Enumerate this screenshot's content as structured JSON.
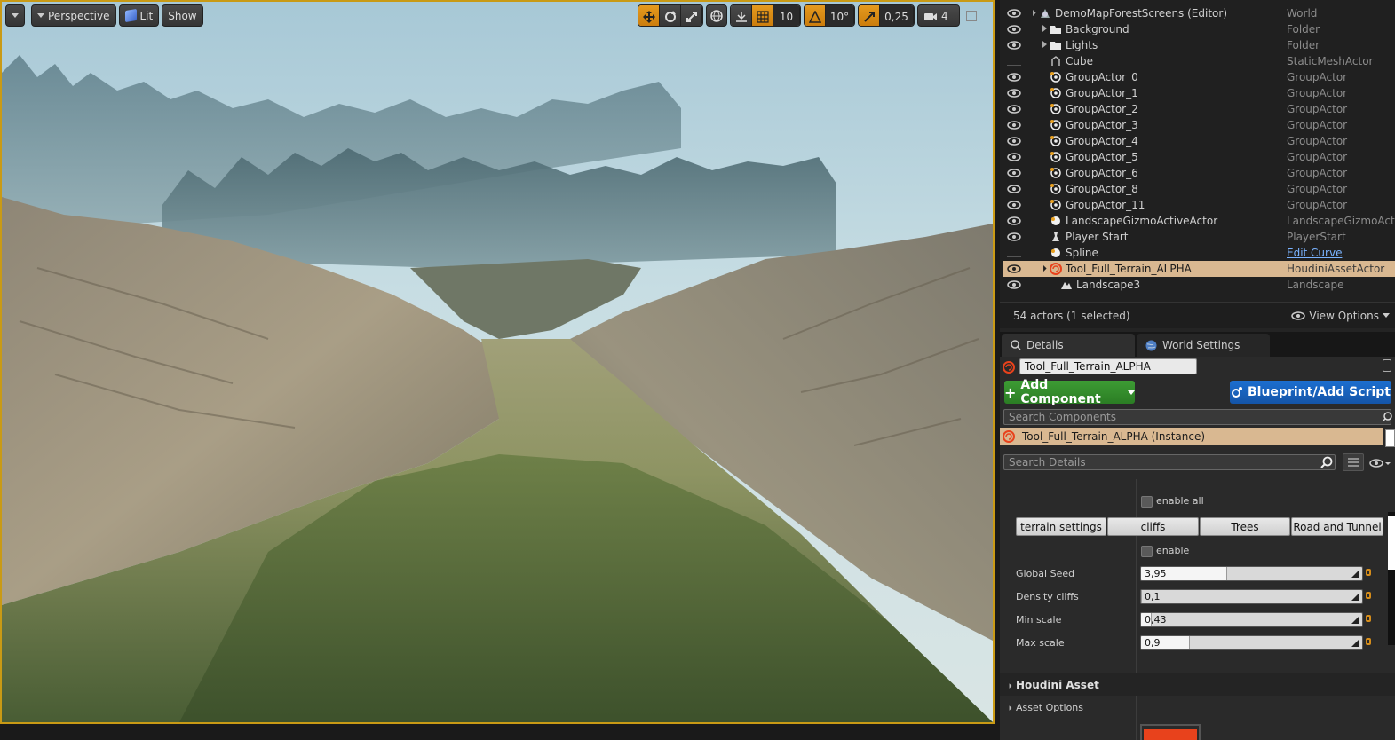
{
  "viewport": {
    "menu_dropdown": "▾",
    "view_mode": "Perspective",
    "lighting": "Lit",
    "show": "Show",
    "grid_snap": "10",
    "rotation_snap": "10°",
    "scale_snap": "0,25",
    "camera_speed": "4",
    "accent_color": "#c99a15"
  },
  "outliner": {
    "rows": [
      {
        "label": "DemoMapForestScreens (Editor)",
        "type": "World",
        "icon": "world-icon",
        "eye": true,
        "expander": "open",
        "indent": 0
      },
      {
        "label": "Background",
        "type": "Folder",
        "icon": "folder-icon",
        "eye": true,
        "expander": "closed",
        "indent": 1
      },
      {
        "label": "Lights",
        "type": "Folder",
        "icon": "folder-icon",
        "eye": true,
        "expander": "closed",
        "indent": 1
      },
      {
        "label": "Cube",
        "type": "StaticMeshActor",
        "icon": "static-mesh-icon",
        "eye": false,
        "indent": 1
      },
      {
        "label": "GroupActor_0",
        "type": "GroupActor",
        "icon": "group-actor-icon",
        "eye": true,
        "indent": 1
      },
      {
        "label": "GroupActor_1",
        "type": "GroupActor",
        "icon": "group-actor-icon",
        "eye": true,
        "indent": 1
      },
      {
        "label": "GroupActor_2",
        "type": "GroupActor",
        "icon": "group-actor-icon",
        "eye": true,
        "indent": 1
      },
      {
        "label": "GroupActor_3",
        "type": "GroupActor",
        "icon": "group-actor-icon",
        "eye": true,
        "indent": 1
      },
      {
        "label": "GroupActor_4",
        "type": "GroupActor",
        "icon": "group-actor-icon",
        "eye": true,
        "indent": 1
      },
      {
        "label": "GroupActor_5",
        "type": "GroupActor",
        "icon": "group-actor-icon",
        "eye": true,
        "indent": 1
      },
      {
        "label": "GroupActor_6",
        "type": "GroupActor",
        "icon": "group-actor-icon",
        "eye": true,
        "indent": 1
      },
      {
        "label": "GroupActor_8",
        "type": "GroupActor",
        "icon": "group-actor-icon",
        "eye": true,
        "indent": 1
      },
      {
        "label": "GroupActor_11",
        "type": "GroupActor",
        "icon": "group-actor-icon",
        "eye": true,
        "indent": 1
      },
      {
        "label": "LandscapeGizmoActiveActor",
        "type": "LandscapeGizmoActiv",
        "icon": "sphere-icon",
        "eye": true,
        "indent": 1
      },
      {
        "label": "Player Start",
        "type": "PlayerStart",
        "icon": "player-start-icon",
        "eye": true,
        "indent": 1
      },
      {
        "label": "Spline",
        "type": "Edit Curve",
        "type_is_link": true,
        "icon": "sphere-icon",
        "eye": false,
        "indent": 1
      },
      {
        "label": "Tool_Full_Terrain_ALPHA",
        "type": "HoudiniAssetActor",
        "icon": "houdini-icon",
        "eye": true,
        "expander": "open",
        "indent": 1,
        "selected": true
      },
      {
        "label": "Landscape3",
        "type": "Landscape",
        "icon": "landscape-icon",
        "eye": true,
        "indent": 2
      }
    ],
    "footer_count": "54 actors (1 selected)",
    "view_options": "View Options"
  },
  "tabs": [
    {
      "label": "Details",
      "icon": "details-icon",
      "active": true
    },
    {
      "label": "World Settings",
      "icon": "world-settings-icon",
      "active": false
    }
  ],
  "details": {
    "actor_name": "Tool_Full_Terrain_ALPHA",
    "add_component": "Add Component",
    "blueprint": "Blueprint/Add Script",
    "search_components_placeholder": "Search Components",
    "instance_label": "Tool_Full_Terrain_ALPHA (Instance)",
    "search_details_placeholder": "Search Details",
    "enable_all": "enable all",
    "categories": [
      "terrain settings",
      "cliffs",
      "Trees",
      "Road and Tunnel"
    ],
    "enable": "enable",
    "params": [
      {
        "label": "Global Seed",
        "value": "3,95",
        "fill": 0.39
      },
      {
        "label": "Density cliffs",
        "value": "0,1",
        "fill": 0.0
      },
      {
        "label": "Min scale",
        "value": "0,43",
        "fill": 0.05
      },
      {
        "label": "Max scale",
        "value": "0,9",
        "fill": 0.22
      }
    ],
    "section_houdini": "Houdini Asset",
    "subsection_asset_options": "Asset Options",
    "houdini_color": "#e8421c"
  }
}
